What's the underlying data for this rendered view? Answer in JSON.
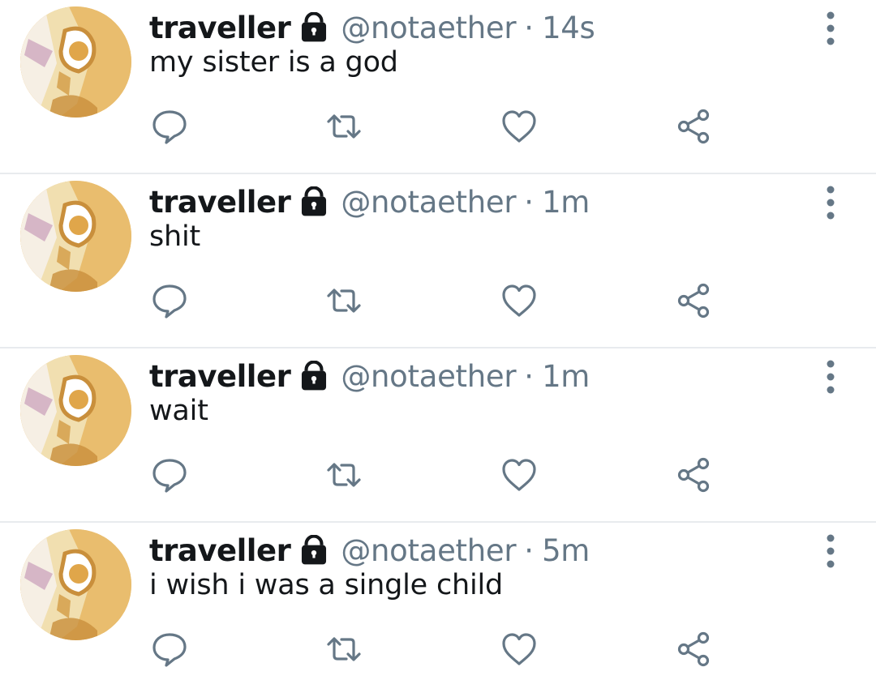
{
  "colors": {
    "text_primary": "#14171a",
    "text_secondary": "#657786",
    "icon": "#657786",
    "divider": "#e8ebee",
    "avatar_bg": "#e9bd6e"
  },
  "tweets": [
    {
      "display_name": "traveller",
      "handle": "@notaether",
      "separator": "·",
      "time": "14s",
      "text": "my sister is a god",
      "icons": {
        "lock": "lock-icon",
        "more": "more-vertical-icon",
        "reply": "reply-icon",
        "retweet": "retweet-icon",
        "like": "heart-icon",
        "share": "share-icon"
      }
    },
    {
      "display_name": "traveller",
      "handle": "@notaether",
      "separator": "·",
      "time": "1m",
      "text": "shit",
      "icons": {
        "lock": "lock-icon",
        "more": "more-vertical-icon",
        "reply": "reply-icon",
        "retweet": "retweet-icon",
        "like": "heart-icon",
        "share": "share-icon"
      }
    },
    {
      "display_name": "traveller",
      "handle": "@notaether",
      "separator": "·",
      "time": "1m",
      "text": "wait",
      "icons": {
        "lock": "lock-icon",
        "more": "more-vertical-icon",
        "reply": "reply-icon",
        "retweet": "retweet-icon",
        "like": "heart-icon",
        "share": "share-icon"
      }
    },
    {
      "display_name": "traveller",
      "handle": "@notaether",
      "separator": "·",
      "time": "5m",
      "text": "i wish i was a single child",
      "icons": {
        "lock": "lock-icon",
        "more": "more-vertical-icon",
        "reply": "reply-icon",
        "retweet": "retweet-icon",
        "like": "heart-icon",
        "share": "share-icon"
      }
    }
  ]
}
